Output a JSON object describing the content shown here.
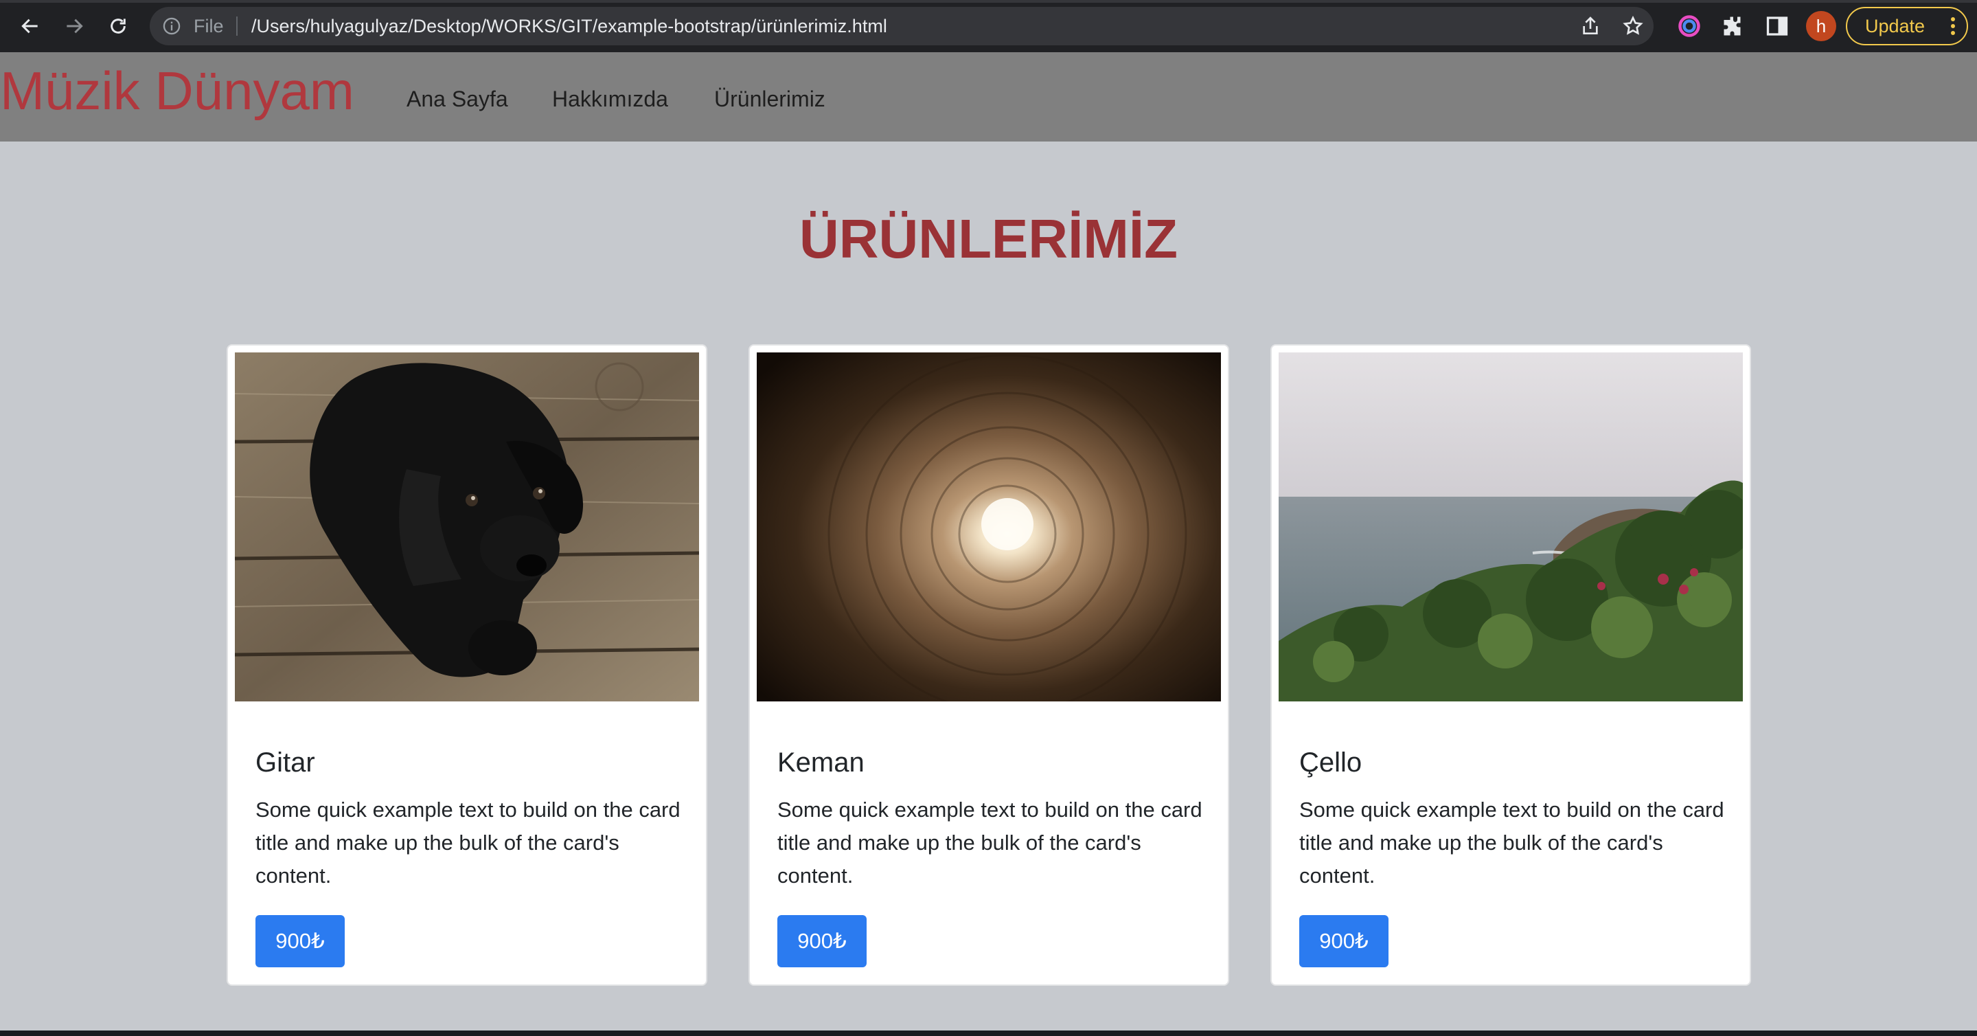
{
  "browser": {
    "file_label": "File",
    "url": "/Users/hulyagulyaz/Desktop/WORKS/GIT/example-bootstrap/ürünlerimiz.html",
    "avatar_letter": "h",
    "update_label": "Update"
  },
  "navbar": {
    "brand": "Müzik Dünyam",
    "links": [
      "Ana Sayfa",
      "Hakkımızda",
      "Ürünlerimiz"
    ]
  },
  "main": {
    "heading": "ÜRÜNLERİMİZ"
  },
  "cards": [
    {
      "image": "black-puppy-on-wooden-floor",
      "title": "Gitar",
      "text": "Some quick example text to build on the card title and make up the bulk of the card's content.",
      "price": "900₺"
    },
    {
      "image": "light-at-end-of-tunnel",
      "title": "Keman",
      "text": "Some quick example text to build on the card title and make up the bulk of the card's content.",
      "price": "900₺"
    },
    {
      "image": "sea-coast-with-shrubs",
      "title": "Çello",
      "text": "Some quick example text to build on the card title and make up the bulk of the card's content.",
      "price": "900₺"
    }
  ],
  "colors": {
    "brand": "#b0383e",
    "heading": "#9a3236",
    "navbar_bg": "#808080",
    "page_bg": "#c6c9ce",
    "button": "#2b7bf0"
  }
}
